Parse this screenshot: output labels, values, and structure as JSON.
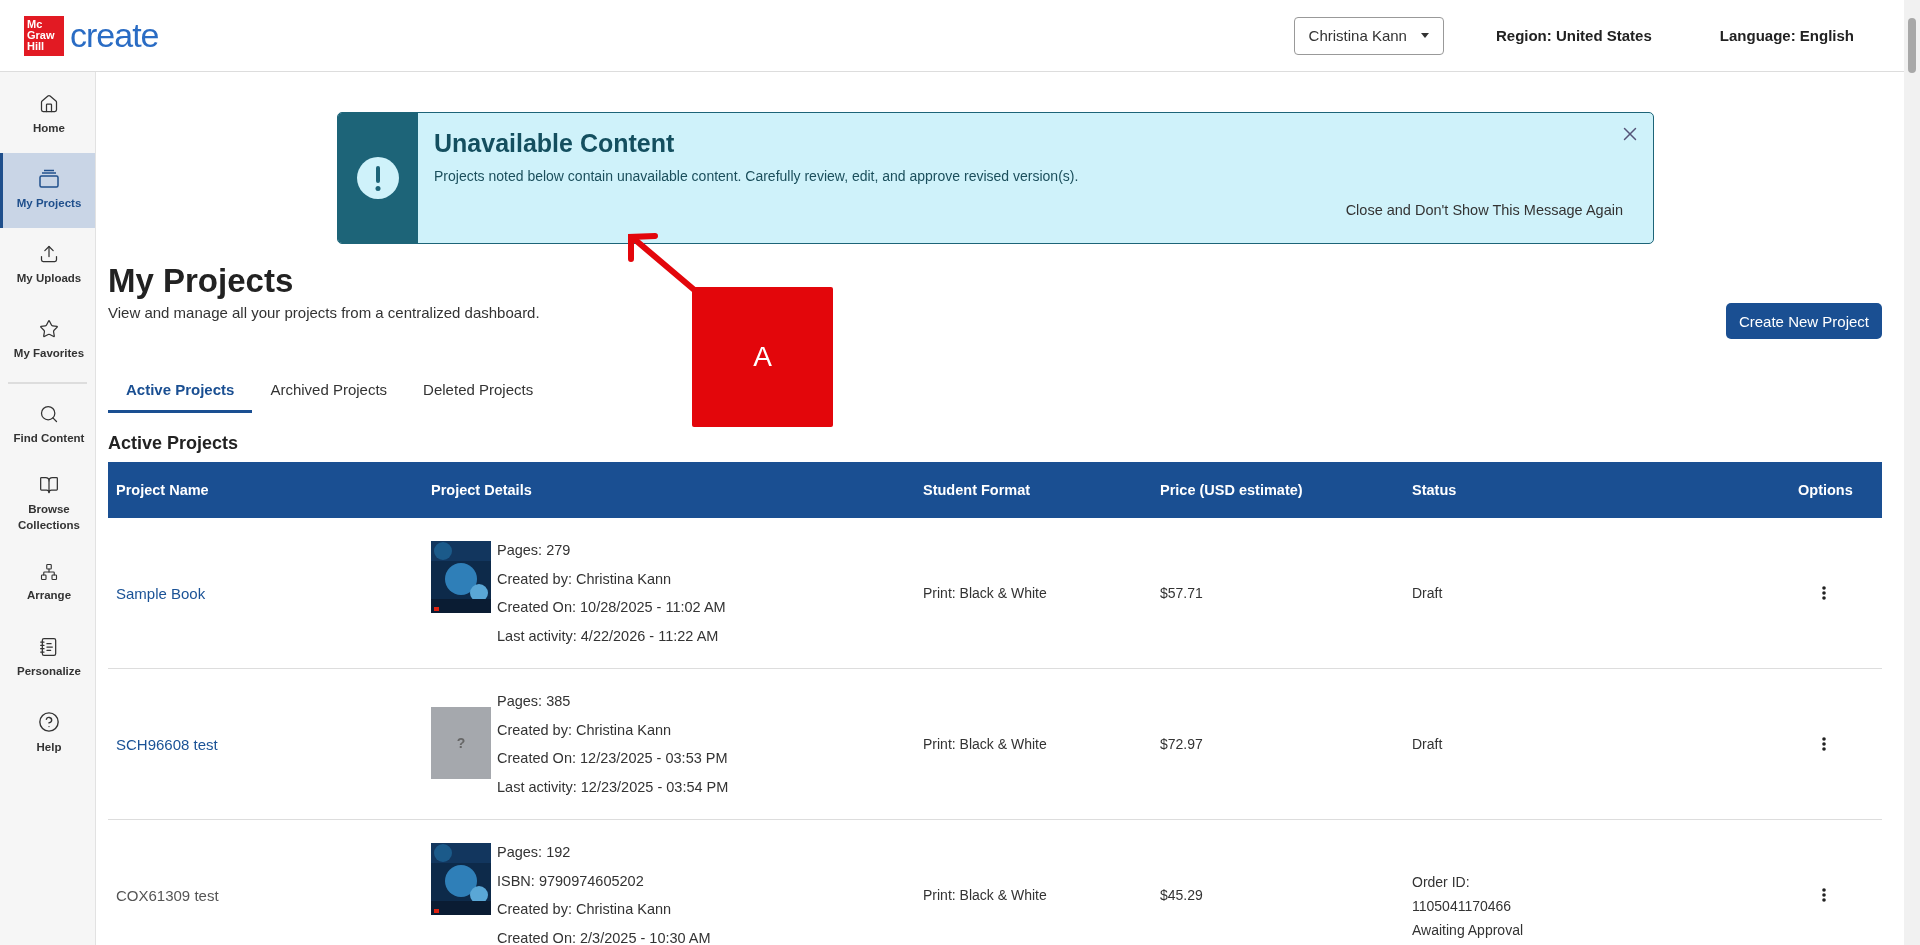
{
  "header": {
    "logo_lines": [
      "Mc",
      "Graw",
      "Hill"
    ],
    "product": "create",
    "user_menu": "Christina Kann",
    "region": "Region: United States",
    "language": "Language: English"
  },
  "sidebar": {
    "items": [
      {
        "label": "Home",
        "selected": false
      },
      {
        "label": "My Projects",
        "selected": true
      },
      {
        "label": "My Uploads",
        "selected": false
      },
      {
        "label": "My Favorites",
        "selected": false
      },
      {
        "label": "Find Content",
        "selected": false
      },
      {
        "label": "Browse Collections",
        "selected": false
      },
      {
        "label": "Arrange",
        "selected": false
      },
      {
        "label": "Personalize",
        "selected": false
      },
      {
        "label": "Help",
        "selected": false
      }
    ]
  },
  "alert": {
    "title": "Unavailable Content",
    "message": "Projects noted below contain unavailable content. Carefully review, edit, and approve revised version(s).",
    "dismiss_link": "Close and Don't Show This Message Again"
  },
  "page": {
    "title": "My Projects",
    "subtitle": "View and manage all your projects from a centralized dashboard.",
    "create_button": "Create New Project"
  },
  "tabs": [
    {
      "label": "Active Projects",
      "selected": true
    },
    {
      "label": "Archived Projects",
      "selected": false
    },
    {
      "label": "Deleted Projects",
      "selected": false
    }
  ],
  "section_title": "Active Projects",
  "table": {
    "columns": [
      "Project Name",
      "Project Details",
      "Student Format",
      "Price (USD estimate)",
      "Status",
      "Options"
    ],
    "rows": [
      {
        "name": "Sample Book",
        "muted": false,
        "cover": {
          "kind": "picture"
        },
        "details": [
          "Pages: 279",
          "Created by: Christina Kann",
          "Created On: 10/28/2025 - 11:02 AM",
          "Last activity: 4/22/2026 - 11:22 AM"
        ],
        "format": "Print: Black & White",
        "price": "$57.71",
        "status": [
          "Draft"
        ]
      },
      {
        "name": "SCH96608 test",
        "muted": false,
        "cover": {
          "kind": "placeholder",
          "mark": "?"
        },
        "details": [
          "Pages: 385",
          "Created by: Christina Kann",
          "Created On: 12/23/2025 - 03:53 PM",
          "Last activity: 12/23/2025 - 03:54 PM"
        ],
        "format": "Print: Black & White",
        "price": "$72.97",
        "status": [
          "Draft"
        ]
      },
      {
        "name": "COX61309 test",
        "muted": true,
        "cover": {
          "kind": "picture"
        },
        "details": [
          "Pages: 192",
          "ISBN: 9790974605202",
          "Created by: Christina Kann",
          "Created On: 2/3/2025 - 10:30 AM"
        ],
        "format": "Print: Black & White",
        "price": "$45.29",
        "status": [
          "Order ID:",
          "1105041170466",
          "Awaiting Approval"
        ]
      }
    ]
  },
  "annotation": {
    "label": "A"
  }
}
